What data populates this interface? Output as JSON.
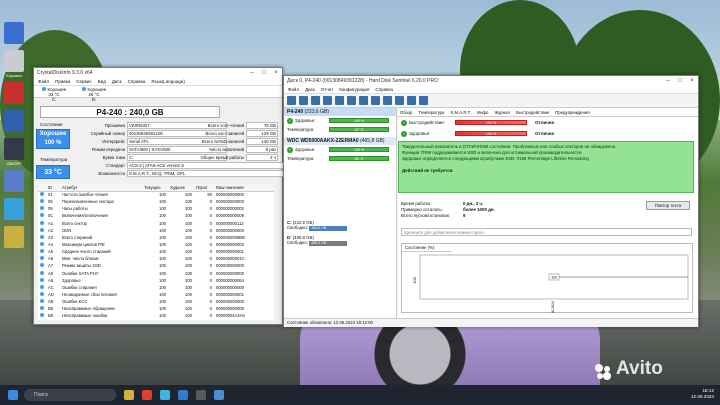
{
  "cdi": {
    "title": "CrystalDiskInfo 9.3.0 x64",
    "menu": [
      "Файл",
      "Правка",
      "Сервис",
      "Вид",
      "Диск",
      "Справка",
      "Язык(Language)"
    ],
    "tabs": [
      {
        "status": "Хорошее",
        "temp": "33 °C",
        "letter": "C:"
      },
      {
        "status": "Хорошее",
        "temp": "26 °C",
        "letter": "D:"
      }
    ],
    "model": "P4-240 : 240,0 GB",
    "health_label": "Состояние",
    "health_value": "Хорошее",
    "health_pct": "100 %",
    "temp_label": "Температура",
    "temp_value": "33 °C",
    "info_left": [
      {
        "k": "Прошивка",
        "v": "VE0R6327"
      },
      {
        "k": "Серийный номер",
        "v": "00130849391228"
      },
      {
        "k": "Интерфейс",
        "v": "Serial ATA"
      },
      {
        "k": "Режим передачи",
        "v": "SATA/600 | SATA/600"
      },
      {
        "k": "Буква тома",
        "v": "C:"
      }
    ],
    "info_right": [
      {
        "k": "Всего хост-чтений",
        "v": "78 GB"
      },
      {
        "k": "Всего хост-записей",
        "v": "129 GB"
      },
      {
        "k": "Всего NAND-записей",
        "v": "140 GB"
      },
      {
        "k": "Число включений",
        "v": "9 раз"
      },
      {
        "k": "Общее время работы",
        "v": "2 ч"
      }
    ],
    "standard_label": "Стандарт",
    "standard_value": "ACS-3 | ATA8-ACS version 6",
    "features_label": "Возможности",
    "features_value": "S.M.A.R.T., NCQ, TRIM, GPL",
    "table_headers": [
      "ID",
      "Атрибут",
      "Текущее",
      "Худшее",
      "Порог",
      "Raw-значения"
    ],
    "table_rows": [
      [
        "01",
        "Частота ошибок чтения",
        "100",
        "100",
        "50",
        "000000000000"
      ],
      [
        "05",
        "Переназначенные сектора",
        "100",
        "100",
        "0",
        "000000000000"
      ],
      [
        "09",
        "Часы работы",
        "100",
        "100",
        "0",
        "000000000002"
      ],
      [
        "0C",
        "Включения/отключения",
        "100",
        "100",
        "0",
        "000000000009"
      ],
      [
        "A1",
        "Всего сектор",
        "100",
        "100",
        "0",
        "000000000112"
      ],
      [
        "A2",
        "ODN",
        "100",
        "100",
        "0",
        "000000000000"
      ],
      [
        "A3",
        "Всего стираний",
        "100",
        "100",
        "0",
        "0000000008BB"
      ],
      [
        "A4",
        "Максимум циклов P/E",
        "100",
        "100",
        "0",
        "000000000002"
      ],
      [
        "A5",
        "Среднее число стираний",
        "100",
        "100",
        "0",
        "000000000001"
      ],
      [
        "A6",
        "Мин. число блоков",
        "100",
        "100",
        "0",
        "00000000001C"
      ],
      [
        "A7",
        "Режим защиты SSD",
        "100",
        "100",
        "0",
        "000000000000"
      ],
      [
        "A8",
        "Ошибки SATA PHY",
        "100",
        "100",
        "0",
        "000000000000"
      ],
      [
        "A9",
        "Здоровье",
        "100",
        "100",
        "0",
        "000000000064"
      ],
      [
        "AC",
        "Ошибки стирания",
        "100",
        "100",
        "0",
        "000000000000"
      ],
      [
        "AD",
        "Неожиданные сбои питания",
        "100",
        "100",
        "0",
        "000000000001"
      ],
      [
        "AE",
        "Ошибки ECC",
        "100",
        "100",
        "0",
        "000000000000"
      ],
      [
        "B5",
        "Неисправимые обращения",
        "100",
        "100",
        "0",
        "000000000000"
      ],
      [
        "B8",
        "Неисправимые ошибки",
        "100",
        "100",
        "0",
        "00000004A4A0"
      ]
    ]
  },
  "hdt": {
    "title": "Диск 0, P4-240 (00130849391228) - Hard Disk Sentinel 6.20.0 PRO",
    "menu": [
      "Файл",
      "Диск",
      "Отчет",
      "Конфигурация",
      "Справка"
    ],
    "drive1": {
      "name": "P4-240",
      "size": "(223,6 GB)",
      "health_label": "Здоровье:",
      "health": "100 %",
      "temp_label": "Температура:",
      "temp": "33 °C"
    },
    "drive2": {
      "name": "WDC WD5000AAKX-22ERMA0",
      "size": "(465,8 GB)",
      "health_label": "Здоровье:",
      "health": "100 %",
      "temp_label": "Температура:",
      "temp": "26 °C"
    },
    "vol1": {
      "letter": "C:",
      "size": "(222,9 GB)",
      "free_label": "Свободно:",
      "free": "165,5 GB"
    },
    "vol2": {
      "letter": "D:",
      "size": "(465,8 GB)",
      "free_label": "Свободно:",
      "free": "465,5 GB"
    },
    "tabs": [
      "Обзор",
      "Температура",
      "S.M.A.R.T.",
      "Инфо",
      "Журнал",
      "Быстродействие",
      "Предупреждения"
    ],
    "perf_label": "Быстродействие:",
    "perf_pct": "100 %",
    "perf_val": "Отлично",
    "health_label": "Здоровье:",
    "health_pct": "100 %",
    "health_val": "Отлично",
    "message_lines": [
      "Твердотельный накопитель в ОТЛИЧНОМ состоянии. Проблемных или слабых секторов не обнаружено.",
      "Функция TRIM поддерживается SSD и включена для оптимальной производительности.",
      "Здоровье определяется следующими атрибутами SSD: #169 Percentage Lifetime Remaining",
      "",
      "Действий не требуется."
    ],
    "kv": [
      {
        "k": "Время работы:",
        "v": "0 дн., 2 ч."
      },
      {
        "k": "Примерно осталось:",
        "v": "более 1000 дн."
      },
      {
        "k": "Всего пусков/остановок:",
        "v": "9"
      }
    ],
    "test_btn": "Повтор теста",
    "comment_placeholder": "Щелкните для добавления комментария...",
    "chart_tab": "Состояние (%)",
    "status": "Состояние обновлено: 12.06.2024 18:12:00"
  },
  "chart_data": {
    "type": "line",
    "x": [
      "12.06.2024"
    ],
    "values": [
      100
    ],
    "y_tick": "100",
    "data_label": "100"
  },
  "taskbar": {
    "search": "Поиск",
    "time": "18:12",
    "date": "12.06.2024"
  },
  "desktop": [
    {
      "label": ""
    },
    {
      "label": "Корзина"
    },
    {
      "label": ""
    },
    {
      "label": ""
    },
    {
      "label": "ON/OFF"
    },
    {
      "label": ""
    },
    {
      "label": ""
    },
    {
      "label": ""
    }
  ],
  "watermark": "Avito"
}
